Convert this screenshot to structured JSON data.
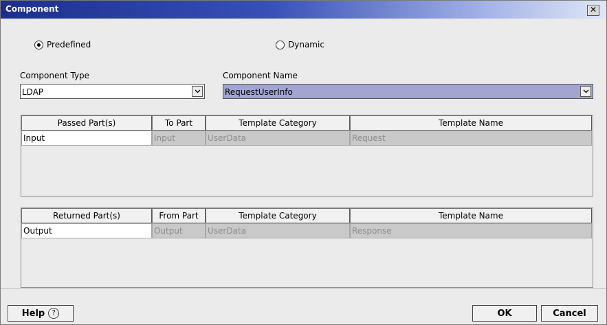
{
  "window": {
    "title": "Component",
    "close_glyph": "✕"
  },
  "mode": {
    "predefined_label": "Predefined",
    "dynamic_label": "Dynamic",
    "selected": "Predefined"
  },
  "component_type": {
    "label": "Component Type",
    "value": "LDAP"
  },
  "component_name": {
    "label": "Component Name",
    "value": "RequestUserInfo"
  },
  "passed_table": {
    "headers": [
      "Passed Part(s)",
      "To Part",
      "Template Category",
      "Template Name"
    ],
    "rows": [
      [
        "Input",
        "Input",
        "UserData",
        "Request"
      ]
    ]
  },
  "returned_table": {
    "headers": [
      "Returned Part(s)",
      "From Part",
      "Template Category",
      "Template Name"
    ],
    "rows": [
      [
        "Output",
        "Output",
        "UserData",
        "Response"
      ]
    ]
  },
  "buttons": {
    "help": "Help",
    "help_icon": "?",
    "ok": "OK",
    "cancel": "Cancel"
  },
  "colors": {
    "title_bar": "#1c2f8e",
    "selection": "#a2a5d0",
    "window_bg": "#ebebeb"
  }
}
